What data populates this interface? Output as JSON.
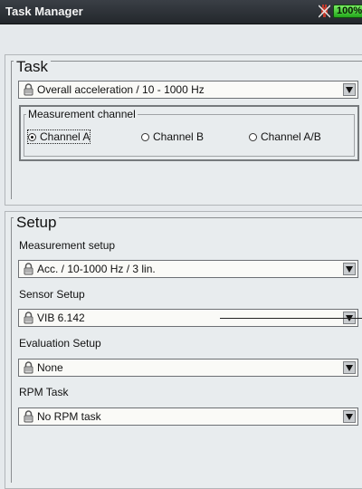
{
  "window": {
    "title": "Task Manager",
    "battery_text": "100%"
  },
  "task": {
    "legend": "Task",
    "combo_value": "Overall acceleration / 10 - 1000 Hz",
    "channel_group": {
      "legend": "Measurement channel",
      "options": [
        {
          "label": "Channel A",
          "selected": true
        },
        {
          "label": "Channel B",
          "selected": false
        },
        {
          "label": "Channel A/B",
          "selected": false
        }
      ]
    }
  },
  "setup": {
    "legend": "Setup",
    "fields": [
      {
        "label": "Measurement setup",
        "value": "Acc. / 10-1000 Hz / 3 lin."
      },
      {
        "label": "Sensor Setup",
        "value": "VIB 6.142"
      },
      {
        "label": "Evaluation Setup",
        "value": "None"
      },
      {
        "label": "RPM Task",
        "value": "No RPM task"
      }
    ]
  },
  "icons": {
    "lock": "padlock-icon",
    "dropdown": "triangle-down-icon",
    "power": "plug-icon"
  },
  "colors": {
    "battery": "#23a81c",
    "titlebar": "#23272c",
    "background": "#e5e9ec"
  }
}
